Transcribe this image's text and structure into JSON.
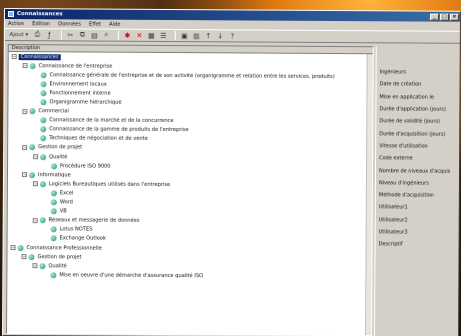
{
  "window": {
    "title": "Connaissances"
  },
  "menu": [
    "Action",
    "Edition",
    "Données",
    "Effet",
    "Aide"
  ],
  "toolbar": {
    "first_label": "Ajout ▾"
  },
  "tree": {
    "header": "Description",
    "rows": [
      {
        "label": "Connaissances",
        "depth": 0,
        "expanded": true,
        "selected": true,
        "node": false
      },
      {
        "label": "Connaissance de l'entreprise",
        "depth": 1,
        "expanded": true,
        "selected": false,
        "node": true
      },
      {
        "label": "Connaissance générale de l'entreprise et de son activité (organigramme et relation entre les services, produits)",
        "depth": 2,
        "expanded": null,
        "selected": false,
        "node": true
      },
      {
        "label": "Environnement locaux",
        "depth": 2,
        "expanded": null,
        "selected": false,
        "node": true
      },
      {
        "label": "Fonctionnement interne",
        "depth": 2,
        "expanded": null,
        "selected": false,
        "node": true
      },
      {
        "label": "Organigramme hiérarchique",
        "depth": 2,
        "expanded": null,
        "selected": false,
        "node": true
      },
      {
        "label": "Commercial",
        "depth": 1,
        "expanded": true,
        "selected": false,
        "node": true
      },
      {
        "label": "Connaissance de la marché et de la concurrence",
        "depth": 2,
        "expanded": null,
        "selected": false,
        "node": true
      },
      {
        "label": "Connaissance de la gamme de produits de l'entreprise",
        "depth": 2,
        "expanded": null,
        "selected": false,
        "node": true
      },
      {
        "label": "Techniques de négociation et de vente",
        "depth": 2,
        "expanded": null,
        "selected": false,
        "node": true
      },
      {
        "label": "Gestion de projet",
        "depth": 1,
        "expanded": true,
        "selected": false,
        "node": true
      },
      {
        "label": "Qualité",
        "depth": 2,
        "expanded": true,
        "selected": false,
        "node": true
      },
      {
        "label": "Procédure ISO 9000",
        "depth": 3,
        "expanded": null,
        "selected": false,
        "node": true
      },
      {
        "label": "Informatique",
        "depth": 1,
        "expanded": true,
        "selected": false,
        "node": true
      },
      {
        "label": "Logiciels Bureautiques utilisés dans l'entreprise",
        "depth": 2,
        "expanded": true,
        "selected": false,
        "node": true
      },
      {
        "label": "Excel",
        "depth": 3,
        "expanded": null,
        "selected": false,
        "node": true
      },
      {
        "label": "Word",
        "depth": 3,
        "expanded": null,
        "selected": false,
        "node": true
      },
      {
        "label": "VB",
        "depth": 3,
        "expanded": null,
        "selected": false,
        "node": true
      },
      {
        "label": "Réseaux et messagerie de données",
        "depth": 2,
        "expanded": true,
        "selected": false,
        "node": true
      },
      {
        "label": "Lotus NOTES",
        "depth": 3,
        "expanded": null,
        "selected": false,
        "node": true
      },
      {
        "label": "Exchange Outlook",
        "depth": 3,
        "expanded": null,
        "selected": false,
        "node": true
      },
      {
        "label": "Connaissance Professionnelle",
        "depth": 0,
        "expanded": true,
        "selected": false,
        "node": true
      },
      {
        "label": "Gestion de projet",
        "depth": 1,
        "expanded": true,
        "selected": false,
        "node": true
      },
      {
        "label": "Qualité",
        "depth": 2,
        "expanded": true,
        "selected": false,
        "node": true
      },
      {
        "label": "Mise en oeuvre d'une démarche d'assurance qualité ISO",
        "depth": 3,
        "expanded": null,
        "selected": false,
        "node": true
      }
    ]
  },
  "properties": [
    "Ingénieurs",
    "Date de création",
    "Mise en application le",
    "Durée d'application (jours)",
    "Durée de validité (jours)",
    "Durée d'acquisition (jours)",
    "Vitesse d'utilisation",
    "Code externe",
    "Nombre de niveaux d'acquis",
    "Niveau d'ingénieurs",
    "Méthode d'acquisition",
    "Utilisateur1",
    "Utilisateur2",
    "Utilisateur3",
    "Descriptif"
  ]
}
